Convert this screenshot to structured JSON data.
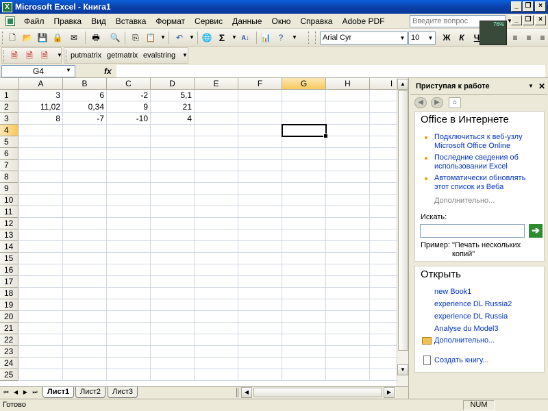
{
  "window": {
    "title": "Microsoft Excel - Книга1"
  },
  "menu": {
    "items": [
      "Файл",
      "Правка",
      "Вид",
      "Вставка",
      "Формат",
      "Сервис",
      "Данные",
      "Окно",
      "Справка",
      "Adobe PDF"
    ],
    "help_placeholder": "Введите вопрос"
  },
  "toolbar": {
    "zoom_badge": "76%",
    "font_name": "Arial Cyr",
    "font_size": "10",
    "bold": "Ж",
    "italic": "К",
    "underline": "Ч"
  },
  "addin_toolbar": {
    "buttons": [
      "putmatrix",
      "getmatrix",
      "evalstring"
    ]
  },
  "formula_bar": {
    "name_box": "G4",
    "fx": "fx",
    "content": ""
  },
  "grid": {
    "columns": [
      "A",
      "B",
      "C",
      "D",
      "E",
      "F",
      "G",
      "H",
      "I"
    ],
    "rows": [
      "1",
      "2",
      "3",
      "4",
      "5",
      "6",
      "7",
      "8",
      "9",
      "10",
      "11",
      "12",
      "13",
      "14",
      "15",
      "16",
      "17",
      "18",
      "19",
      "20",
      "21",
      "22",
      "23",
      "24",
      "25"
    ],
    "selected_column": "G",
    "selected_row": "4",
    "cells": [
      [
        "3",
        "6",
        "-2",
        "5,1"
      ],
      [
        "11,02",
        "0,34",
        "9",
        "21"
      ],
      [
        "8",
        "-7",
        "-10",
        "4"
      ]
    ]
  },
  "sheets": {
    "tabs": [
      "Лист1",
      "Лист2",
      "Лист3"
    ],
    "active": "Лист1"
  },
  "status": {
    "text": "Готово",
    "num": "NUM"
  },
  "task_pane": {
    "title": "Приступая к работе",
    "online_section": "Office в Интернете",
    "links": [
      [
        "Подключиться к веб-узлу",
        "Microsoft Office Online"
      ],
      [
        "Последние сведения об",
        "использовании Excel"
      ],
      [
        "Автоматически обновлять",
        "этот список из Веба"
      ]
    ],
    "more": "Дополнительно...",
    "search_label": "Искать:",
    "example_label": "Пример:",
    "example_text_1": "\"Печать нескольких",
    "example_text_2": "копий\"",
    "open_section": "Открыть",
    "recent_files": [
      "new Book1",
      "experience DL Russia2",
      "experience DL Russia",
      "Analyse du Model3"
    ],
    "open_more": "Дополнительно...",
    "create": "Создать книгу..."
  },
  "colors": {
    "title_bar": "#0b3fa8",
    "selection_header": "#f7c95c",
    "link": "#0033cc",
    "bullet": "#e8a000"
  }
}
